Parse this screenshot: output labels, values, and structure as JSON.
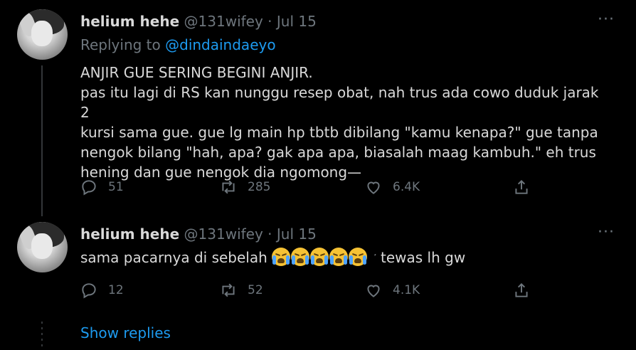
{
  "tweets": [
    {
      "name": "helium hehe",
      "meta": "@131wifey · Jul 15",
      "replying_prefix": "Replying to ",
      "replying_handle": "@dindaindaeyo",
      "lines": [
        "ANJIR GUE SERING BEGINI ANJIR.",
        "pas itu lagi di RS kan nunggu resep obat, nah trus ada cowo duduk jarak 2",
        "kursi sama gue. gue lg main hp tbtb dibilang \"kamu kenapa?\" gue tanpa",
        "nengok bilang \"hah, apa? gak apa apa, biasalah maag kambuh.\" eh trus",
        "hening dan gue nengok dia ngomong—"
      ],
      "replies": "51",
      "retweets": "285",
      "likes": "6.4K"
    },
    {
      "name": "helium hehe",
      "meta": "@131wifey · Jul 15",
      "text_before": "sama pacarnya di sebelah ",
      "emoji_icon": "loudly-crying-face-icon",
      "emoji_count": 5,
      "faint_glyph": "ؘ ؙ",
      "text_after": " tewas lh gw",
      "replies": "12",
      "retweets": "52",
      "likes": "4.1K"
    }
  ],
  "more_label": "···",
  "show_replies": "Show replies",
  "colors": {
    "background": "#000000",
    "text": "#d9d9d9",
    "muted": "#6e767d",
    "link": "#1d9bf0"
  }
}
